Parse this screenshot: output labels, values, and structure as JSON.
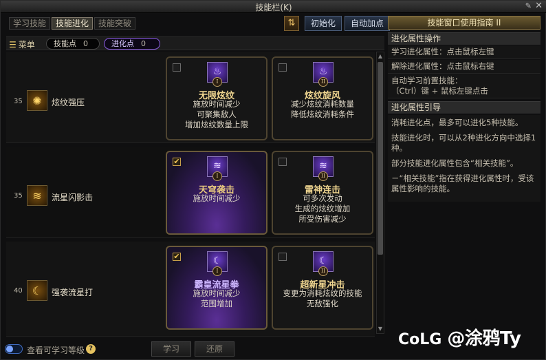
{
  "window": {
    "title": "技能栏(K)"
  },
  "tabs": [
    {
      "label": "学习技能",
      "active": false
    },
    {
      "label": "技能进化",
      "active": true
    },
    {
      "label": "技能突破",
      "active": false
    }
  ],
  "toolbar": {
    "settings_icon": "sort-icon",
    "init_label": "初始化",
    "auto_label": "自动加点"
  },
  "menubar": {
    "menu_label": "菜单",
    "skill_points_label": "技能点",
    "skill_points_value": "0",
    "evo_points_label": "进化点",
    "evo_points_value": "0"
  },
  "skills": [
    {
      "level": "35",
      "name": "炫纹强压",
      "icon": "flame-orb-icon",
      "options": [
        {
          "checked": false,
          "roman": "I",
          "name": "无限炫纹",
          "desc": [
            "施放时间减少",
            "可聚集敌人",
            "增加炫纹数量上限"
          ]
        },
        {
          "checked": false,
          "roman": "II",
          "name": "炫纹旋风",
          "desc": [
            "减少炫纹消耗数量",
            "降低炫纹消耗条件"
          ]
        }
      ]
    },
    {
      "level": "35",
      "name": "流星闪影击",
      "icon": "meteor-strike-icon",
      "options": [
        {
          "checked": true,
          "roman": "I",
          "name": "天穹袭击",
          "desc": [
            "施放时间减少"
          ]
        },
        {
          "checked": false,
          "roman": "II",
          "name": "雷神连击",
          "desc": [
            "可多次发动",
            "生成的炫纹增加",
            "所受伤害减少"
          ]
        }
      ]
    },
    {
      "level": "40",
      "name": "强袭流星打",
      "icon": "crescent-strike-icon",
      "options": [
        {
          "checked": true,
          "roman": "I",
          "name": "霸皇流星拳",
          "desc": [
            "施放时间减少",
            "范围增加"
          ]
        },
        {
          "checked": false,
          "roman": "II",
          "name": "超新星冲击",
          "desc": [
            "变更为消耗炫纹的技能",
            "无敌强化"
          ]
        }
      ]
    }
  ],
  "bottom": {
    "toggle_label": "查看可学习等级",
    "learn_label": "学习",
    "reset_label": "还原"
  },
  "guide": {
    "title": "技能窗口使用指南 II",
    "section1": "进化属性操作",
    "items": [
      "学习进化属性：点击鼠标左键",
      "解除进化属性：点击鼠标右键",
      "自动学习前置技能：",
      "（Ctrl）键 + 鼠标左键点击"
    ],
    "section2": "进化属性引导",
    "paragraphs": [
      "消耗进化点，最多可以进化5种技能。",
      "技能进化时，可以从2种进化方向中选择1种。",
      "部分技能进化属性包含“相关技能”。",
      "－“相关技能”指在获得进化属性时，受该属性影响的技能。"
    ]
  },
  "watermark": {
    "logo": "CoLG",
    "handle": "@涂鸦Ty"
  }
}
